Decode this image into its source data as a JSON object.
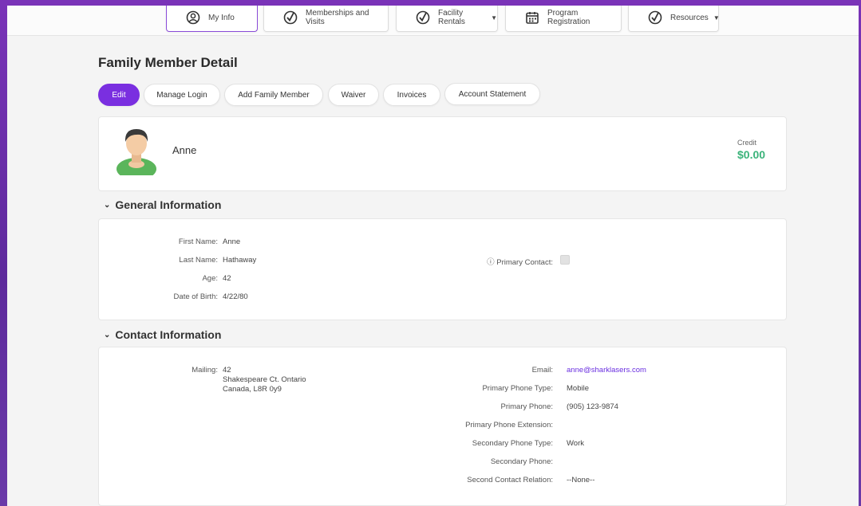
{
  "nav": {
    "items": [
      {
        "label": "My Info"
      },
      {
        "label": "Memberships and Visits"
      },
      {
        "label": "Facility Rentals"
      },
      {
        "label": "Program Registration"
      },
      {
        "label": "Resources"
      }
    ]
  },
  "page": {
    "title": "Family Member Detail"
  },
  "actions": {
    "edit": "Edit",
    "manage_login": "Manage Login",
    "add_family": "Add Family Member",
    "waiver": "Waiver",
    "invoices": "Invoices",
    "statement": "Account Statement"
  },
  "profile": {
    "name": "Anne",
    "credit_label": "Credit",
    "credit_value": "$0.00"
  },
  "general": {
    "heading": "General Information",
    "first_name_label": "First Name:",
    "first_name": "Anne",
    "last_name_label": "Last Name:",
    "last_name": "Hathaway",
    "age_label": "Age:",
    "age": "42",
    "dob_label": "Date of Birth:",
    "dob": "4/22/80",
    "primary_contact_label": "ⓘ Primary Contact:"
  },
  "contact": {
    "heading": "Contact Information",
    "mailing_label": "Mailing:",
    "mailing_line1": "42",
    "mailing_line2": "Shakespeare Ct. Ontario",
    "mailing_line3": "Canada, L8R 0y9",
    "email_label": "Email:",
    "email": "anne@sharklasers.com",
    "primary_phone_type_label": "Primary Phone Type:",
    "primary_phone_type": "Mobile",
    "primary_phone_label": "Primary Phone:",
    "primary_phone": "(905) 123-9874",
    "primary_ext_label": "Primary Phone Extension:",
    "secondary_type_label": "Secondary Phone Type:",
    "secondary_type": "Work",
    "secondary_phone_label": "Secondary Phone:",
    "second_relation_label": "Second Contact Relation:",
    "second_relation": "--None--"
  },
  "colors": {
    "accent": "#7a2fe0",
    "credit": "#3bb37a",
    "frame": "#6a2fa8"
  }
}
